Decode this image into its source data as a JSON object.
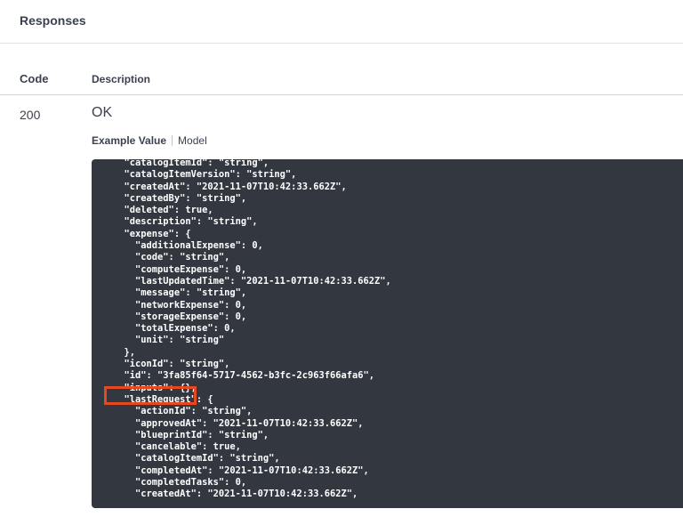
{
  "responses": {
    "title": "Responses",
    "columns": {
      "code": "Code",
      "description": "Description"
    },
    "row": {
      "code": "200",
      "description": "OK"
    },
    "tabs": {
      "example_value": "Example Value",
      "model": "Model"
    }
  },
  "code_lines": [
    "  \"catalogItemId\": \"string\",",
    "  \"catalogItemVersion\": \"string\",",
    "  \"createdAt\": \"2021-11-07T10:42:33.662Z\",",
    "  \"createdBy\": \"string\",",
    "  \"deleted\": true,",
    "  \"description\": \"string\",",
    "  \"expense\": {",
    "    \"additionalExpense\": 0,",
    "    \"code\": \"string\",",
    "    \"computeExpense\": 0,",
    "    \"lastUpdatedTime\": \"2021-11-07T10:42:33.662Z\",",
    "    \"message\": \"string\",",
    "    \"networkExpense\": 0,",
    "    \"storageExpense\": 0,",
    "    \"totalExpense\": 0,",
    "    \"unit\": \"string\"",
    "  },",
    "  \"iconId\": \"string\",",
    "  \"id\": \"3fa85f64-5717-4562-b3fc-2c963f66afa6\",",
    "  \"inputs\": {},",
    "  \"lastRequest\": {",
    "    \"actionId\": \"string\",",
    "    \"approvedAt\": \"2021-11-07T10:42:33.662Z\",",
    "    \"blueprintId\": \"string\",",
    "    \"cancelable\": true,",
    "    \"catalogItemId\": \"string\",",
    "    \"completedAt\": \"2021-11-07T10:42:33.662Z\",",
    "    \"completedTasks\": 0,",
    "    \"createdAt\": \"2021-11-07T10:42:33.662Z\","
  ],
  "colors": {
    "code_background": "#333840",
    "highlight": "#e8481f"
  }
}
